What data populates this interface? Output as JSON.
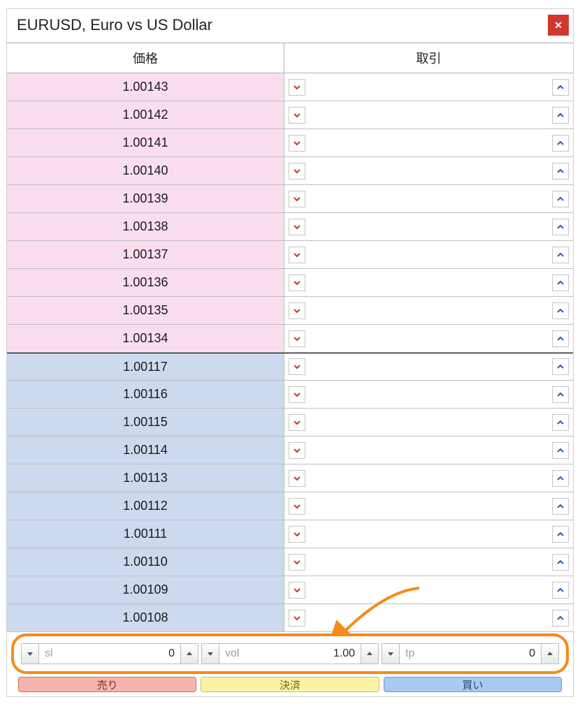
{
  "title": "EURUSD, Euro vs US Dollar",
  "columns": {
    "price": "価格",
    "trade": "取引"
  },
  "ask_rows": [
    "1.00143",
    "1.00142",
    "1.00141",
    "1.00140",
    "1.00139",
    "1.00138",
    "1.00137",
    "1.00136",
    "1.00135",
    "1.00134"
  ],
  "bid_rows": [
    "1.00117",
    "1.00116",
    "1.00115",
    "1.00114",
    "1.00113",
    "1.00112",
    "1.00111",
    "1.00110",
    "1.00109",
    "1.00108"
  ],
  "inputs": {
    "sl": {
      "placeholder": "sl",
      "value": "0"
    },
    "vol": {
      "placeholder": "vol",
      "value": "1.00"
    },
    "tp": {
      "placeholder": "tp",
      "value": "0"
    }
  },
  "buttons": {
    "sell": "売り",
    "close": "決済",
    "buy": "買い"
  }
}
